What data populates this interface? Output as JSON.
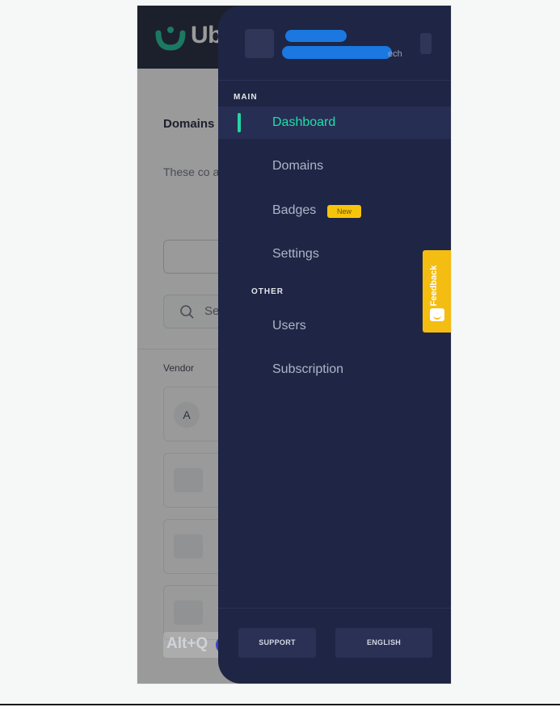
{
  "app": {
    "brand_text": "Ub"
  },
  "page": {
    "card_title": "Domains explicit c",
    "card_desc": "These co and put y complianc",
    "search_placeholder": "Se",
    "table_header_vendor": "Vendor",
    "row_initial": "A",
    "hotkey": "Alt+Q"
  },
  "drawer": {
    "org_sub_suffix": "ech",
    "sections": {
      "main": "MAIN",
      "other": "OTHER"
    },
    "items": [
      {
        "label": "Dashboard",
        "active": true
      },
      {
        "label": "Domains"
      },
      {
        "label": "Badges",
        "badge": "New"
      },
      {
        "label": "Settings"
      },
      {
        "label": "Users"
      },
      {
        "label": "Subscription"
      }
    ],
    "footer": {
      "support": "SUPPORT",
      "language": "ENGLISH"
    }
  },
  "feedback": {
    "label": "Feedback"
  },
  "colors": {
    "drawer_bg": "#1f2544",
    "accent": "#1fe0a6",
    "badge": "#f6c40c",
    "feedback": "#f4bd12"
  }
}
